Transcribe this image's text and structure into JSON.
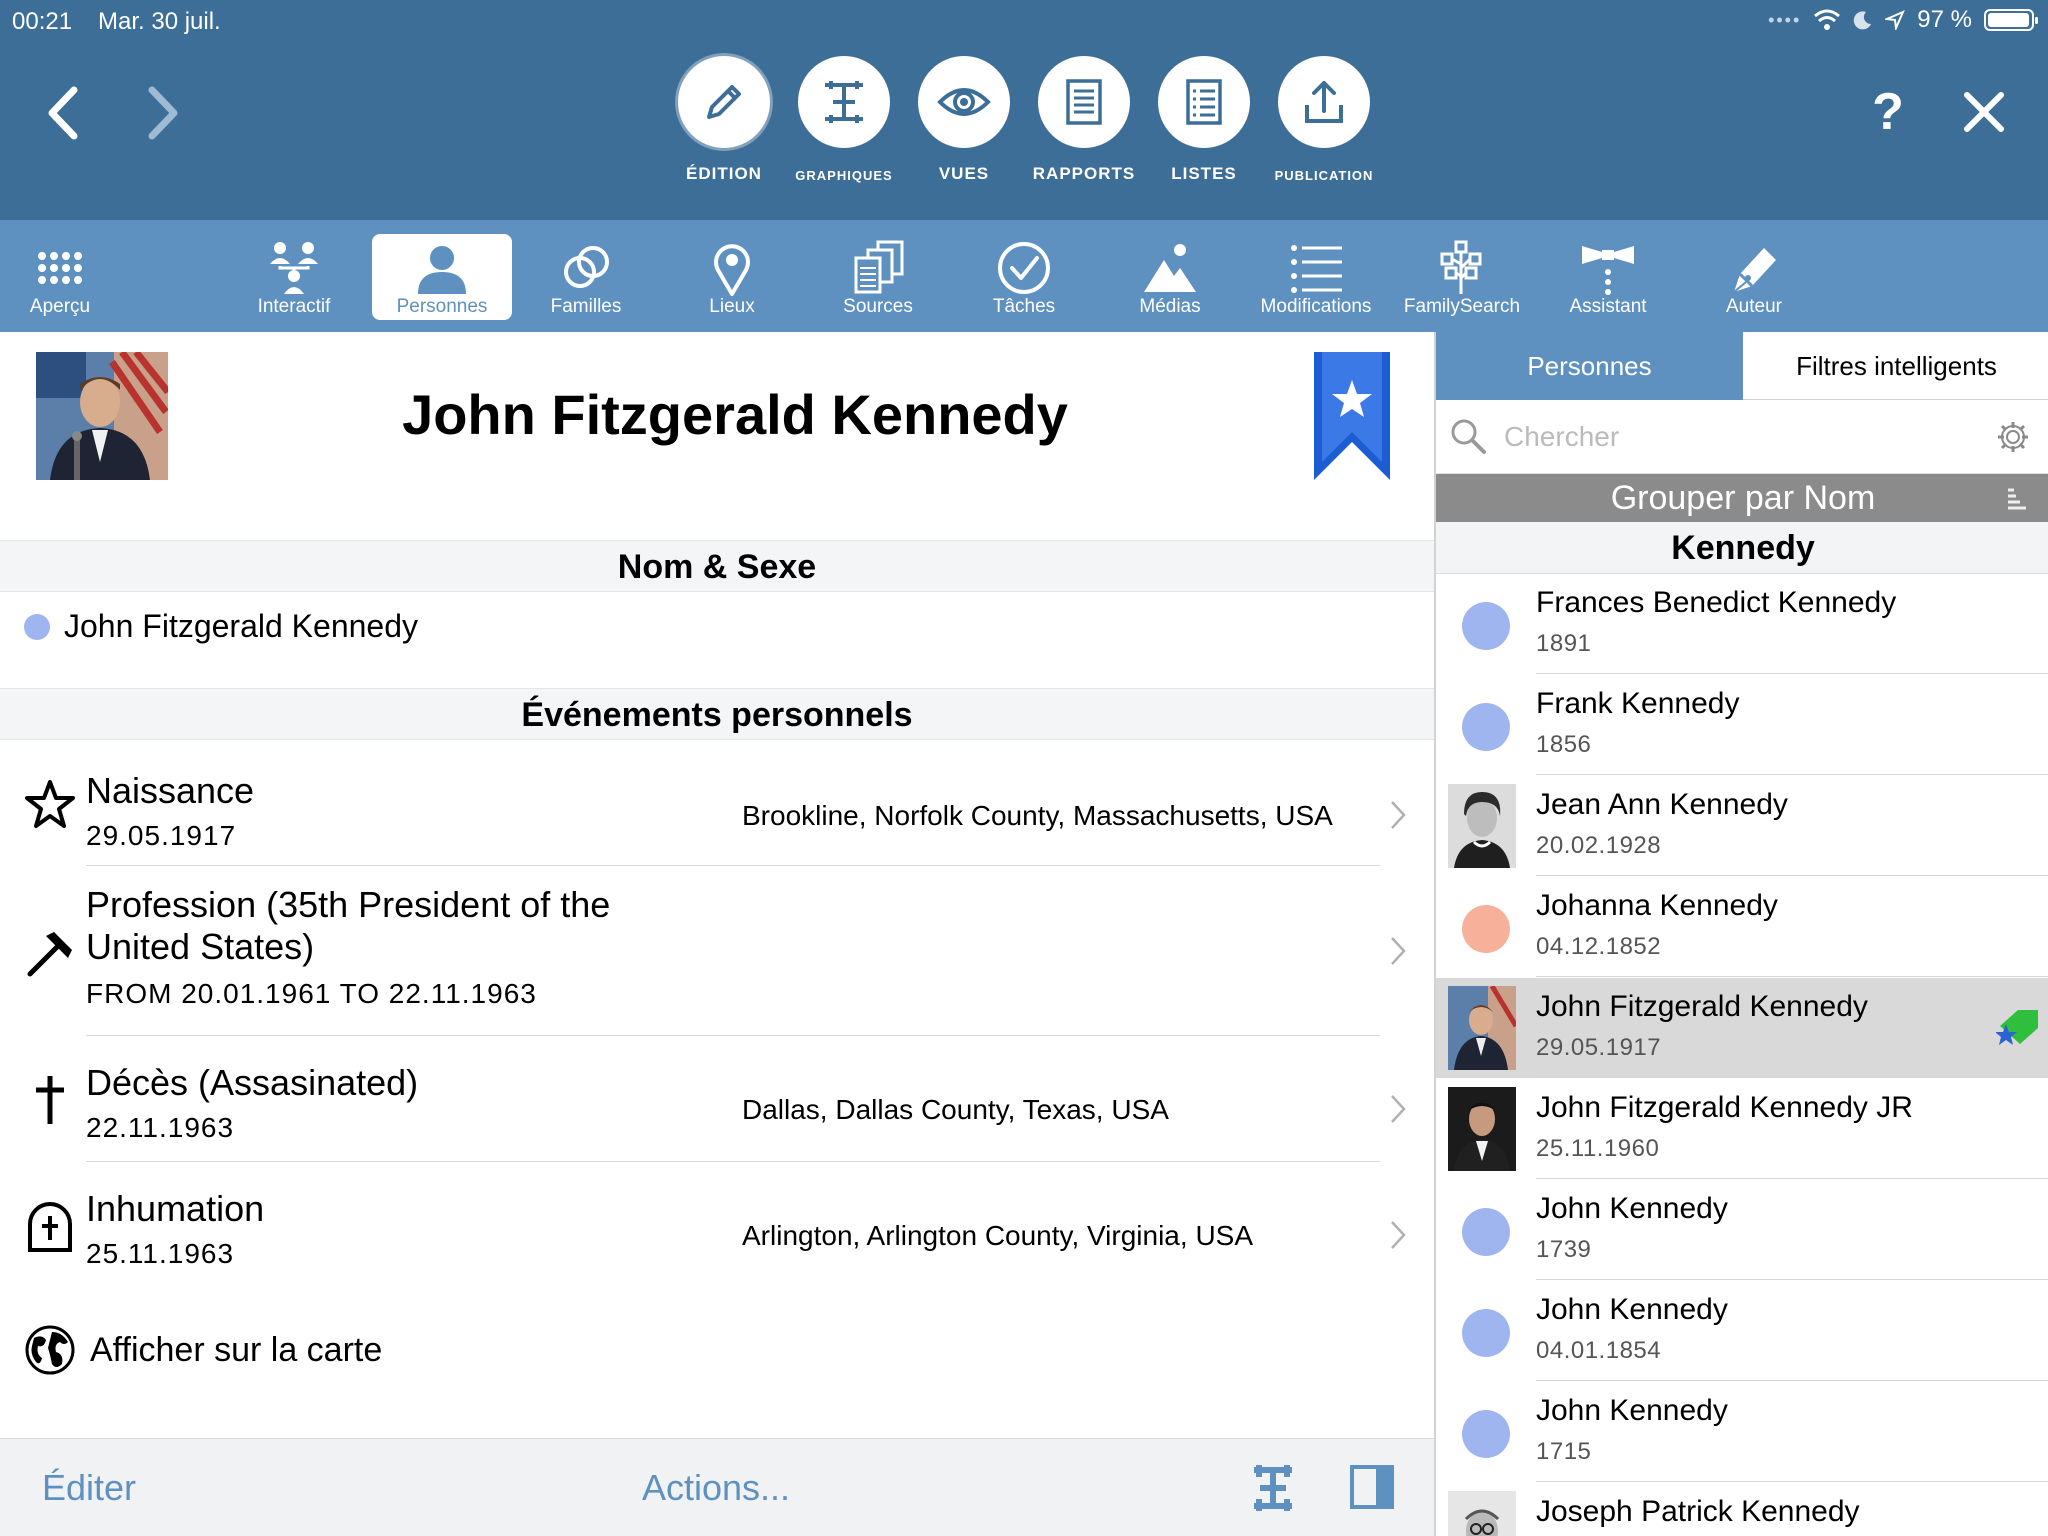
{
  "status": {
    "time": "00:21",
    "date": "Mar. 30 juil.",
    "battery": "97 %",
    "battery_level": 0.97
  },
  "modes": [
    {
      "label": "ÉDITION",
      "icon": "pencil-icon",
      "active": true
    },
    {
      "label": "GRAPHIQUES",
      "icon": "chart-icon"
    },
    {
      "label": "VUES",
      "icon": "eye-icon"
    },
    {
      "label": "RAPPORTS",
      "icon": "report-icon"
    },
    {
      "label": "LISTES",
      "icon": "list-doc-icon"
    },
    {
      "label": "PUBLICATION",
      "icon": "upload-icon"
    }
  ],
  "header": {
    "help": "?",
    "close": "✕"
  },
  "tools": [
    {
      "label": "Aperçu",
      "icon": "grid-icon"
    },
    {
      "label": "Interactif",
      "icon": "tree-icon"
    },
    {
      "label": "Personnes",
      "icon": "person-icon",
      "active": true
    },
    {
      "label": "Familles",
      "icon": "rings-icon"
    },
    {
      "label": "Lieux",
      "icon": "pin-icon"
    },
    {
      "label": "Sources",
      "icon": "sources-icon"
    },
    {
      "label": "Tâches",
      "icon": "check-icon"
    },
    {
      "label": "Médias",
      "icon": "media-icon"
    },
    {
      "label": "Modifications",
      "icon": "list-icon"
    },
    {
      "label": "FamilySearch",
      "icon": "familysearch-icon"
    },
    {
      "label": "Assistant",
      "icon": "assistant-icon"
    },
    {
      "label": "Auteur",
      "icon": "author-icon"
    }
  ],
  "person": {
    "name": "John Fitzgerald Kennedy",
    "sections": {
      "name_sex": "Nom & Sexe",
      "events": "Événements personnels"
    },
    "display_name": "John Fitzgerald Kennedy",
    "gender_color": "#9fb5ef",
    "events": [
      {
        "icon": "star-icon",
        "title": "Naissance",
        "date": "29.05.1917",
        "place": "Brookline, Norfolk County, Massachusetts, USA"
      },
      {
        "icon": "hammer-icon",
        "title": "Profession (35th President of the United States)",
        "date": "FROM 20.01.1961 TO 22.11.1963",
        "place": ""
      },
      {
        "icon": "cross-icon",
        "title": "Décès (Assasinated)",
        "date": "22.11.1963",
        "place": "Dallas, Dallas County, Texas, USA"
      },
      {
        "icon": "grave-icon",
        "title": "Inhumation",
        "date": "25.11.1963",
        "place": "Arlington, Arlington County, Virginia, USA"
      }
    ],
    "map_link": "Afficher sur la carte"
  },
  "bottom": {
    "edit": "Éditer",
    "actions": "Actions..."
  },
  "sidebar": {
    "tabs": [
      "Personnes",
      "Filtres intelligents"
    ],
    "search_placeholder": "Chercher",
    "group_by": "Grouper par Nom",
    "group_name": "Kennedy",
    "people": [
      {
        "name": "Frances Benedict Kennedy",
        "date": "1891",
        "avatar": "dot",
        "color": "#9fb5ef"
      },
      {
        "name": "Frank Kennedy",
        "date": "1856",
        "avatar": "dot",
        "color": "#9fb5ef"
      },
      {
        "name": "Jean Ann Kennedy",
        "date": "20.02.1928",
        "avatar": "photo"
      },
      {
        "name": "Johanna Kennedy",
        "date": "04.12.1852",
        "avatar": "dot",
        "color": "#f7b19a"
      },
      {
        "name": "John Fitzgerald Kennedy",
        "date": "29.05.1917",
        "avatar": "photo",
        "selected": true
      },
      {
        "name": "John Fitzgerald Kennedy JR",
        "date": "25.11.1960",
        "avatar": "photo"
      },
      {
        "name": "John Kennedy",
        "date": "1739",
        "avatar": "dot",
        "color": "#9fb5ef"
      },
      {
        "name": "John Kennedy",
        "date": "04.01.1854",
        "avatar": "dot",
        "color": "#9fb5ef"
      },
      {
        "name": "John Kennedy",
        "date": "1715",
        "avatar": "dot",
        "color": "#9fb5ef"
      },
      {
        "name": "Joseph Patrick Kennedy",
        "date": "",
        "avatar": "photo"
      }
    ]
  }
}
